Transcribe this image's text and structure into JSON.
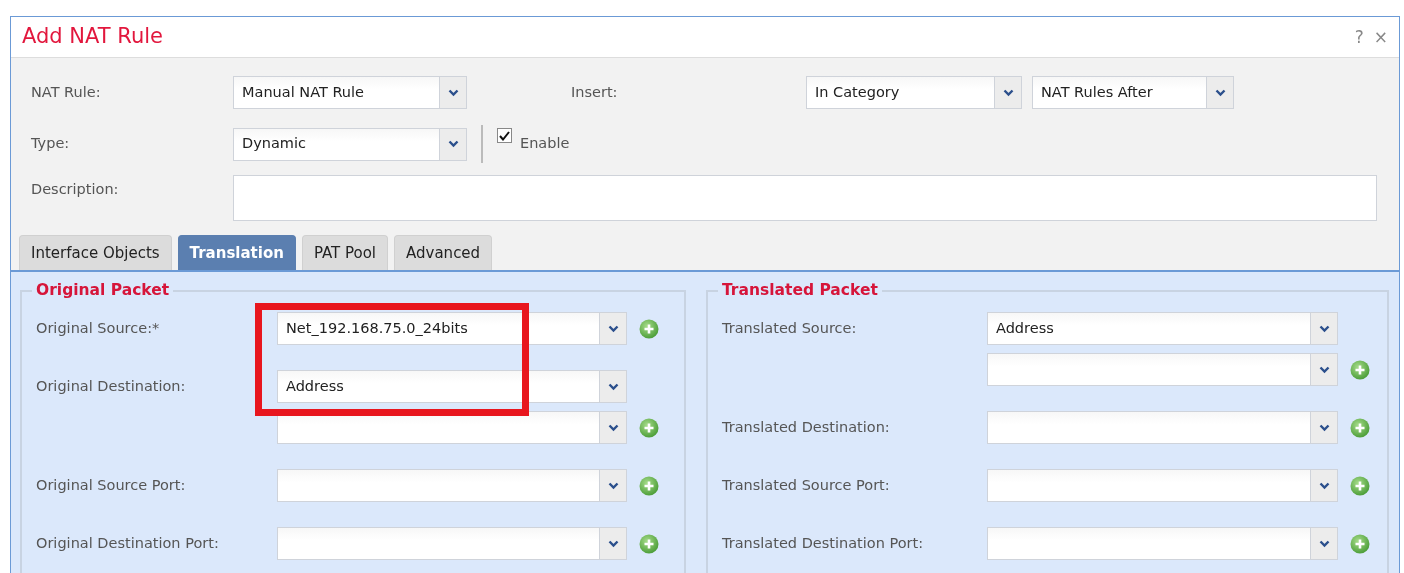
{
  "dialog": {
    "title": "Add NAT Rule",
    "help": "?",
    "close": "×"
  },
  "header": {
    "nat_rule": {
      "label": "NAT Rule:",
      "value": "Manual NAT Rule"
    },
    "insert": {
      "label": "Insert:",
      "values": [
        "In Category",
        "NAT Rules After"
      ]
    },
    "type": {
      "label": "Type:",
      "value": "Dynamic"
    },
    "enable": {
      "label": "Enable",
      "checked": true
    },
    "description": {
      "label": "Description:"
    }
  },
  "tabs": [
    {
      "label": "Interface Objects",
      "selected": false
    },
    {
      "label": "Translation",
      "selected": true
    },
    {
      "label": "PAT Pool",
      "selected": false
    },
    {
      "label": "Advanced",
      "selected": false
    }
  ],
  "sections": [
    {
      "legend": "Original Packet",
      "rows": [
        {
          "label": "Original Source:*",
          "value": "Net_192.168.75.0_24bits",
          "add": true,
          "highlighted": true
        },
        {
          "label": "Original Destination:",
          "value": "Address",
          "add": false,
          "highlighted": true
        },
        {
          "add": true,
          "highlighted": false
        },
        {
          "label": "Original Source Port:",
          "add": true,
          "highlighted": false
        },
        {
          "label": "Original Destination Port:",
          "add": true,
          "highlighted": false
        }
      ]
    },
    {
      "legend": "Translated Packet",
      "rows": [
        {
          "label": "Translated Source:",
          "value": "Address",
          "add": false,
          "highlighted": false
        },
        {
          "add": true,
          "highlighted": false
        },
        {
          "label": "Translated Destination:",
          "add": true,
          "highlighted": false
        },
        {
          "label": "Translated Source Port:",
          "add": true,
          "highlighted": false
        },
        {
          "label": "Translated Destination Port:",
          "add": true,
          "highlighted": false
        }
      ]
    }
  ]
}
